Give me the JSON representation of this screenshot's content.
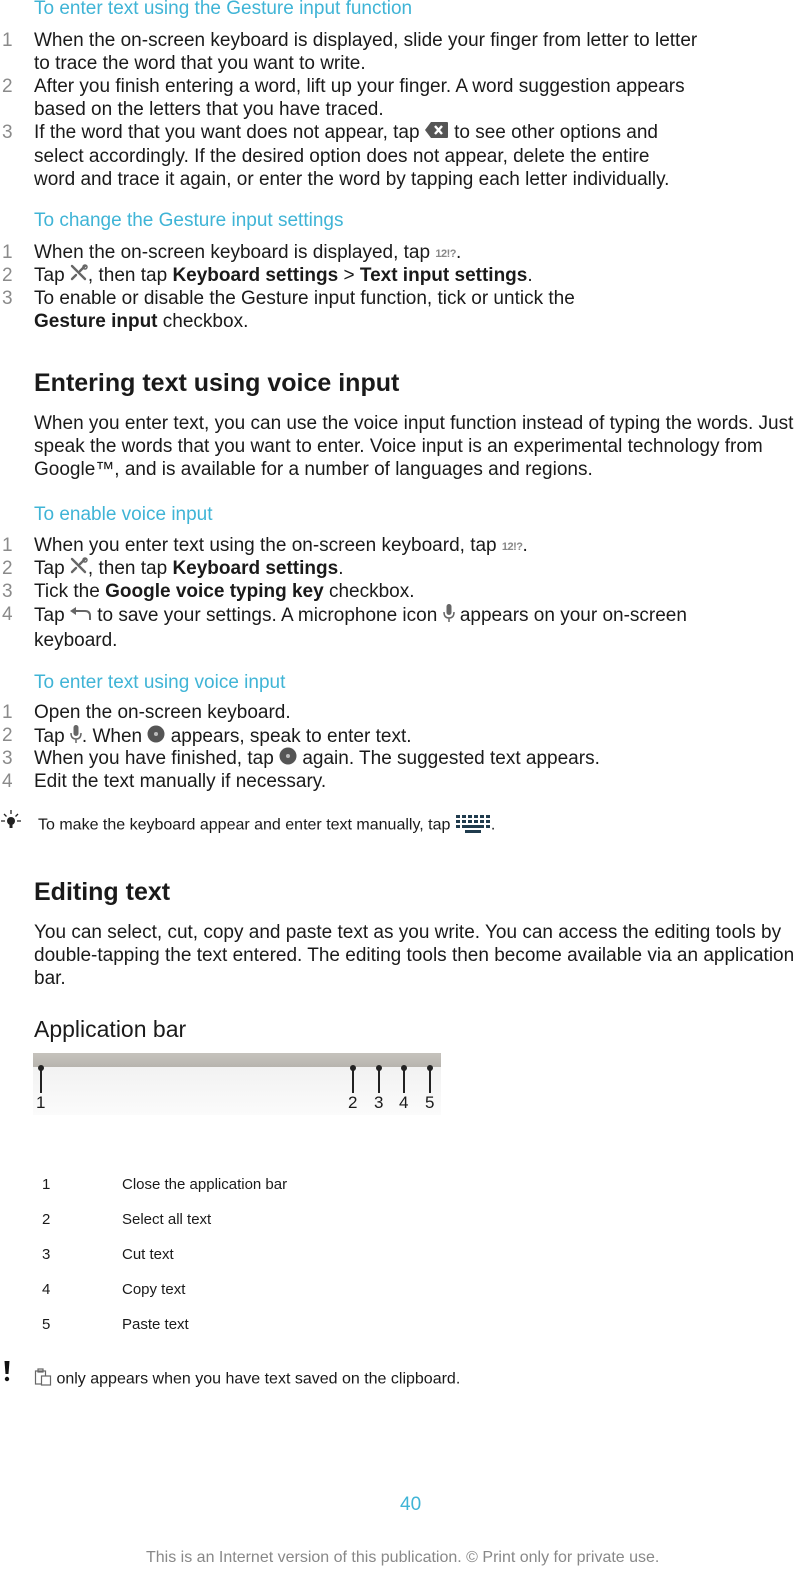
{
  "sections": {
    "gesture_enter": {
      "title": "To enter text using the Gesture input function",
      "steps": [
        {
          "num": "1",
          "line1": "When the on-screen keyboard is displayed, slide your finger from letter to letter",
          "line2": "to trace the word that you want to write."
        },
        {
          "num": "2",
          "line1": "After you finish entering a word, lift up your finger. A word suggestion appears",
          "line2": "based on the letters that you have traced."
        },
        {
          "num": "3",
          "pre": "If the word that you want does not appear, tap",
          "post": "to see other options and",
          "line2": "select accordingly. If the desired option does not appear, delete the entire",
          "line3": "word and trace it again, or enter the word by tapping each letter individually."
        }
      ]
    },
    "gesture_settings": {
      "title": "To change the Gesture input settings",
      "steps": [
        {
          "num": "1",
          "pre": "When the on-screen keyboard is displayed, tap",
          "key": "12!?",
          "post": "."
        },
        {
          "num": "2",
          "pre": "Tap",
          "mid": ", then tap",
          "bold1": "Keyboard settings",
          "sep": ">",
          "bold2": "Text input settings",
          "post": "."
        },
        {
          "num": "3",
          "line1": "To enable or disable the Gesture input function, tick or untick the",
          "bold": "Gesture input",
          "post": "checkbox."
        }
      ]
    },
    "voice": {
      "heading": "Entering text using voice input",
      "intro": "When you enter text, you can use the voice input function instead of typing the words. Just speak the words that you want to enter. Voice input is an experimental technology from Google™, and is available for a number of languages and regions."
    },
    "voice_enable": {
      "title": "To enable voice input",
      "steps": [
        {
          "num": "1",
          "pre": "When you enter text using the on-screen keyboard, tap",
          "key": "12!?",
          "post": "."
        },
        {
          "num": "2",
          "pre": "Tap",
          "mid": ", then tap",
          "bold": "Keyboard settings",
          "post": "."
        },
        {
          "num": "3",
          "pre": "Tick the",
          "bold": "Google voice typing key",
          "post": "checkbox."
        },
        {
          "num": "4",
          "pre": "Tap",
          "mid": "to save your settings. A microphone icon",
          "post": "appears on your on-screen",
          "line2": "keyboard."
        }
      ]
    },
    "voice_enter": {
      "title": "To enter text using voice input",
      "steps": [
        {
          "num": "1",
          "text": "Open the on-screen keyboard."
        },
        {
          "num": "2",
          "pre": "Tap",
          "mid": ". When",
          "post": "appears, speak to enter text."
        },
        {
          "num": "3",
          "pre": "When you have finished, tap",
          "post": "again. The suggested text appears."
        },
        {
          "num": "4",
          "text": "Edit the text manually if necessary."
        }
      ],
      "tip": {
        "pre": "To make the keyboard appear and enter text manually, tap",
        "post": "."
      }
    },
    "editing": {
      "heading": "Editing text",
      "intro": "You can select, cut, copy and paste text as you write. You can access the editing tools by double-tapping the text entered. The editing tools then become available via an application bar.",
      "appbar_heading": "Application bar",
      "callouts": [
        "1",
        "2",
        "3",
        "4",
        "5"
      ],
      "legend": [
        {
          "num": "1",
          "desc": "Close the application bar"
        },
        {
          "num": "2",
          "desc": "Select all text"
        },
        {
          "num": "3",
          "desc": "Cut text"
        },
        {
          "num": "4",
          "desc": "Copy text"
        },
        {
          "num": "5",
          "desc": "Paste text"
        }
      ],
      "note": "only appears when you have text saved on the clipboard."
    }
  },
  "footer": {
    "page_number": "40",
    "notice": "This is an Internet version of this publication. © Print only for private use."
  },
  "colors": {
    "accent": "#3fb4d6",
    "text": "#1a1a1a",
    "muted": "#8a8a8a"
  }
}
